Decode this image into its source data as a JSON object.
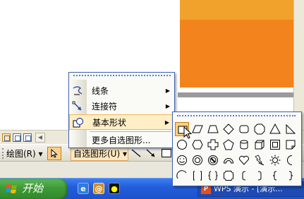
{
  "toolbar": {
    "draw_label": "绘图(R)",
    "draw_arrow": "▾",
    "autoshape_label": "自选图形(U)",
    "autoshape_arrow": "▾",
    "select_icon": "cursor-pointer-icon"
  },
  "autoshape_menu": {
    "items": [
      {
        "icon": "lines-icon",
        "label": "线条",
        "arrow": "▶"
      },
      {
        "icon": "connectors-icon",
        "label": "连接符",
        "arrow": "▶"
      },
      {
        "icon": "basic-shapes-icon",
        "label": "基本形状",
        "arrow": "▶"
      },
      {
        "icon": "",
        "label": "更多自选图形...",
        "arrow": ""
      }
    ]
  },
  "basic_shapes": {
    "rows": [
      [
        "rectangle",
        "parallelogram",
        "trapezoid",
        "diamond",
        "rounded-rectangle",
        "octagon",
        "isosceles-triangle",
        "right-triangle"
      ],
      [
        "oval",
        "hexagon",
        "cross",
        "pentagon",
        "can",
        "cube",
        "bevel",
        "folded-corner"
      ],
      [
        "smiley-face",
        "donut",
        "no-symbol",
        "block-arc",
        "heart",
        "lightning-bolt",
        "sun",
        "moon"
      ],
      [
        "arc",
        "double-bracket",
        "double-brace",
        "plaque",
        "left-bracket",
        "right-bracket",
        "left-brace",
        "right-brace"
      ]
    ]
  },
  "taskbar": {
    "start_label": "开始",
    "app_label": "WPS 演示 - [演示..."
  },
  "colors": {
    "slide_orange": "#f3831d",
    "slide_orange_light": "#f0a22c",
    "menu_highlight": "#ffeec6",
    "menu_border": "#3d63b5",
    "taskbar_blue": "#245edb",
    "start_green": "#3e9a37"
  }
}
